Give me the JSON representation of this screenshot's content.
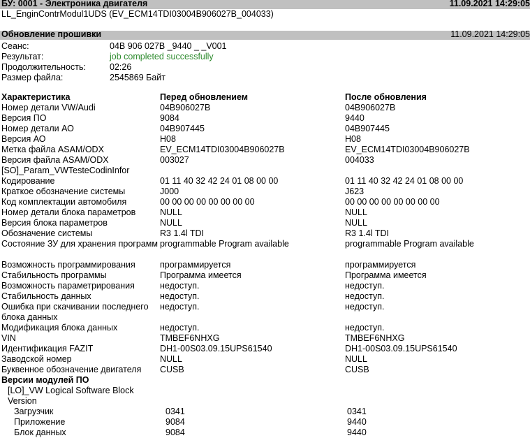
{
  "header": {
    "title": "БУ: 0001 - Электроника двигателя",
    "datetime": "11.09.2021 14:29:05",
    "subtitle": "LL_EnginContrModul1UDS (EV_ECM14TDI03004B906027B_004033)"
  },
  "update_section": {
    "title": "Обновление прошивки",
    "datetime": "11.09.2021 14:29:05"
  },
  "session": {
    "session_label": "Сеанс:",
    "session_value": "04B 906 027B _9440 _ _V001",
    "result_label": "Результат:",
    "result_value": "job completed successfully",
    "result_color": "#2e8b2e",
    "duration_label": "Продолжительность:",
    "duration_value": "02:26",
    "size_label": "Размер файла:",
    "size_value": "2545869 Байт"
  },
  "table": {
    "headers": [
      "Характеристика",
      "Перед обновлением",
      "После обновления"
    ],
    "rows": [
      {
        "name": "Номер детали VW/Audi",
        "before": "04B906027B",
        "after": "04B906027B"
      },
      {
        "name": "Версия ПО",
        "before": "9084",
        "after": "9440"
      },
      {
        "name": "Номер детали АО",
        "before": "04B907445",
        "after": "04B907445"
      },
      {
        "name": "Версия АО",
        "before": "H08",
        "after": "H08"
      },
      {
        "name": "Метка файла ASAM/ODX",
        "before": "EV_ECM14TDI03004B906027B",
        "after": "EV_ECM14TDI03004B906027B"
      },
      {
        "name": "Версия файла ASAM/ODX",
        "before": "003027",
        "after": "004033"
      },
      {
        "name": "[SO]_Param_VWTesteCodinInfor",
        "before": "",
        "after": ""
      },
      {
        "name": "Кодирование",
        "before": "01 11 40 32 42 24 01 08 00 00",
        "after": "01 11 40 32 42 24 01 08 00 00"
      },
      {
        "name": "Краткое обозначение системы",
        "before": "J000",
        "after": "J623"
      },
      {
        "name": "Код комплектации автомобиля",
        "before": "00 00 00 00 00 00 00 00",
        "after": "00 00 00 00 00 00 00 00"
      },
      {
        "name": "Номер детали блока параметров",
        "before": "NULL",
        "after": "NULL"
      },
      {
        "name": "Версия блока параметров",
        "before": "NULL",
        "after": "NULL"
      },
      {
        "name": "Обозначение системы",
        "before": "R3 1.4l TDI",
        "after": "R3 1.4l TDI"
      },
      {
        "name": "Состояние ЗУ для хранения программ",
        "before": "programmable Program available",
        "after": "programmable Program available"
      },
      {
        "name": "Возможность программирования",
        "before": "программируется",
        "after": "программируется"
      },
      {
        "name": "Стабильность программы",
        "before": "Программа имеется",
        "after": "Программа имеется"
      },
      {
        "name": "Возможность параметрирования",
        "before": "недоступ.",
        "after": "недоступ."
      },
      {
        "name": "Стабильность данных",
        "before": "недоступ.",
        "after": "недоступ."
      },
      {
        "name": "Ошибка при скачивании последнего блока данных",
        "before": "недоступ.",
        "after": "недоступ."
      },
      {
        "name": "Модификация блока данных",
        "before": "недоступ.",
        "after": "недоступ."
      },
      {
        "name": "VIN",
        "before": "TMBEF6NHXG",
        "after": "TMBEF6NHXG"
      },
      {
        "name": "Идентификация FAZIT",
        "before": "DH1-00S03.09.15UPS61540",
        "after": "DH1-00S03.09.15UPS61540"
      },
      {
        "name": "Заводской номер",
        "before": "NULL",
        "after": "NULL"
      },
      {
        "name": "Буквенное обозначение двигателя",
        "before": "CUSB",
        "after": "CUSB"
      }
    ]
  },
  "modules": {
    "title": "Версии модулей ПО",
    "block_name_1": "[LO]_VW Logical Software Block",
    "block_name_2": "Version",
    "rows": [
      {
        "name": "Загрузчик",
        "before": "0341",
        "after": "0341"
      },
      {
        "name": "Приложение",
        "before": "9084",
        "after": "9440"
      },
      {
        "name": "Блок данных",
        "before": "9084",
        "after": "9440"
      }
    ]
  }
}
